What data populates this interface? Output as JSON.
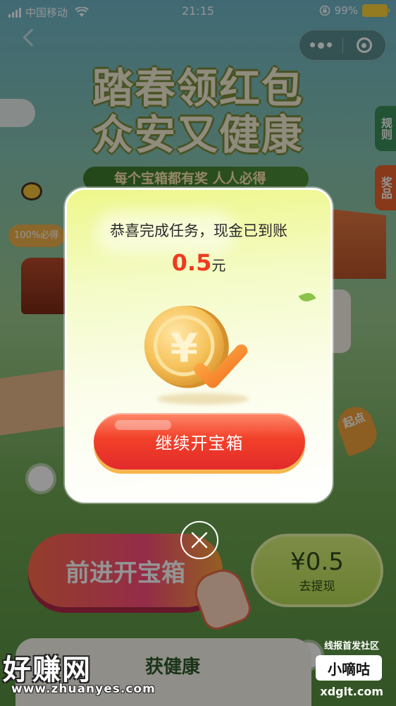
{
  "status_bar": {
    "carrier": "中国移动",
    "time": "21:15",
    "battery": "99%"
  },
  "background": {
    "title_line1": "踏春领红包",
    "title_line2": "众安又健康",
    "side_rules": "规则",
    "side_prizes": "奖品",
    "banner_text": "每个宝箱都有奖 人人必得",
    "percent_tag": "100%必得",
    "start_pin": "起点",
    "advance_button": "前进开宝箱",
    "withdraw_amount": "¥0.5",
    "withdraw_label": "去提现",
    "bottom_text": "获健康"
  },
  "modal": {
    "title": "恭喜完成任务，现金已到账",
    "amount": "0.5",
    "unit": "元",
    "button_label": "继续开宝箱",
    "coin_symbol": "¥"
  },
  "watermark": {
    "left_logo": "好赚网",
    "left_url": "www.zhuanyes.com",
    "right_title": "线报首发社区",
    "right_badge": "小嘀咕",
    "right_url": "xdglt.com"
  },
  "colors": {
    "amount": "#ee3b1f",
    "button": "#f2412a",
    "coin": "#f2b84a",
    "check": "#f4822a"
  }
}
